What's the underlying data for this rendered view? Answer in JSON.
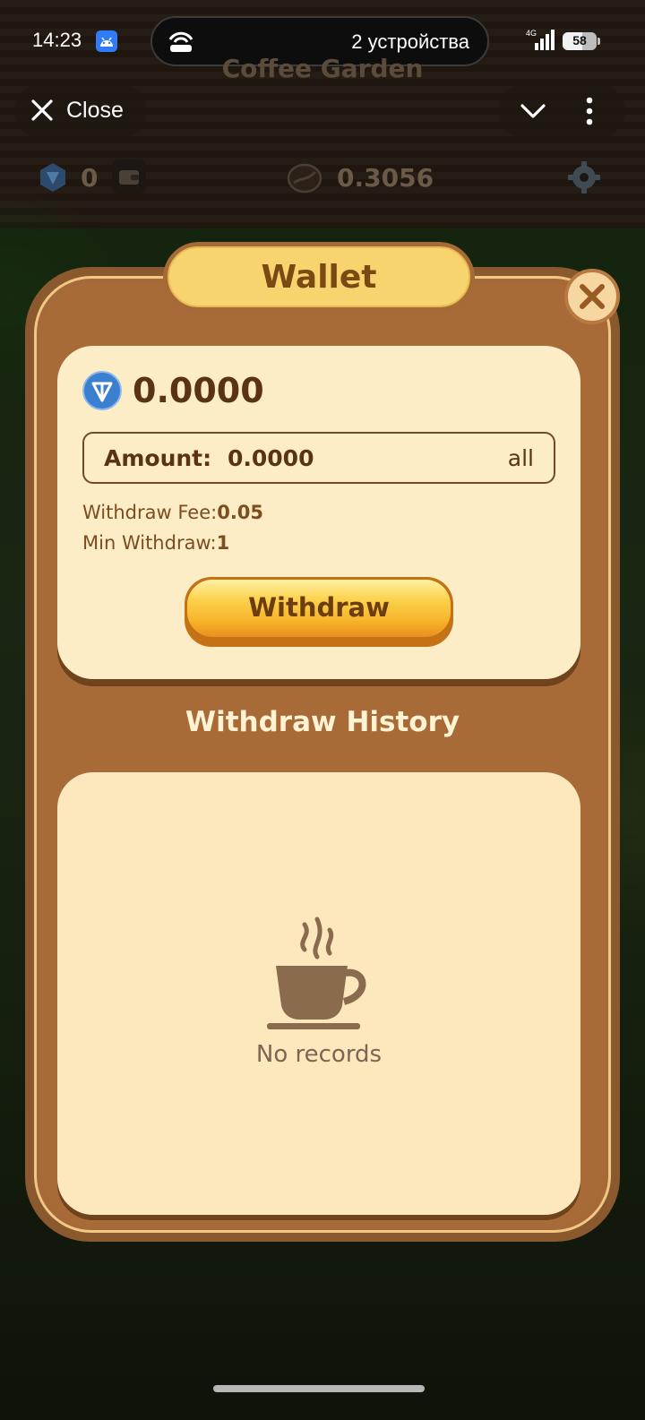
{
  "status_bar": {
    "time": "14:23",
    "island_text": "2 устройства",
    "network": "4G",
    "battery_level": 58,
    "battery_label": "58"
  },
  "telegram_bar": {
    "close_label": "Close",
    "icons": [
      "close-icon",
      "chevron-down-icon",
      "more-vertical-icon"
    ]
  },
  "game_header": {
    "title": "Coffee Garden",
    "ton_balance": "0",
    "beans_balance": "0.3056",
    "icons": [
      "ton-gem-icon",
      "wallet-icon",
      "coffee-bean-icon",
      "gear-icon"
    ]
  },
  "wallet_modal": {
    "title": "Wallet",
    "balance": "0.0000",
    "amount_label": "Amount:",
    "amount_value": "0.0000",
    "all_label": "all",
    "fee_label": "Withdraw Fee:",
    "fee_value": "0.05",
    "min_label": "Min Withdraw:",
    "min_value": "1",
    "withdraw_button": "Withdraw",
    "history_title": "Withdraw History",
    "empty_text": "No records",
    "colors": {
      "frame": "#8a5a2e",
      "card": "#fdedc6",
      "title_tab": "#f8d46e",
      "button": "#fbd24c",
      "text_dark": "#5a3412"
    }
  }
}
